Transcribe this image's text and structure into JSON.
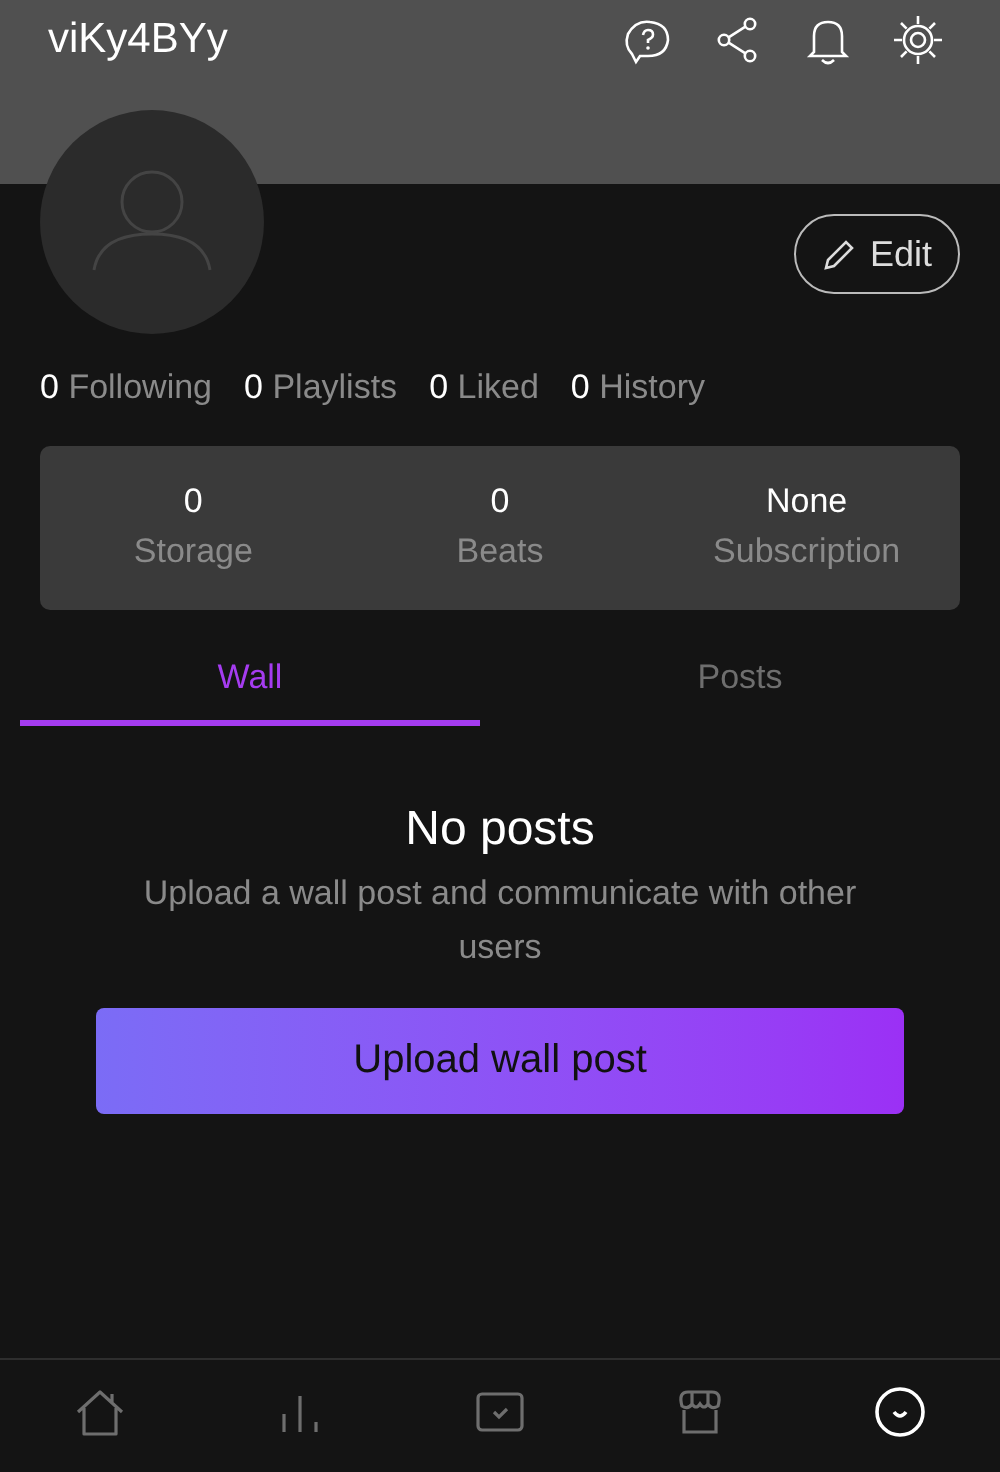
{
  "header": {
    "username": "viKy4BYy"
  },
  "header_actions": [
    {
      "kind": "help"
    },
    {
      "kind": "share"
    },
    {
      "kind": "bell"
    },
    {
      "kind": "settings"
    }
  ],
  "edit_button": {
    "label": "Edit"
  },
  "counts": [
    {
      "text": "0 Following"
    },
    {
      "text": "0 Playlists"
    },
    {
      "text": "0 Liked"
    },
    {
      "text": "0 History"
    }
  ],
  "stats": [
    {
      "value": "0",
      "label": "Storage"
    },
    {
      "value": "0",
      "label": "Beats"
    },
    {
      "value": "None",
      "label": "Subscription"
    }
  ],
  "tabs": [
    {
      "label": "Wall",
      "selected": true
    },
    {
      "label": "Posts",
      "selected": false
    }
  ],
  "empty_state": {
    "title": "No posts",
    "message": "Upload a wall post and communicate with other users",
    "button": "Upload wall post"
  },
  "bottom_nav": [
    {
      "kind": "home",
      "selected": false
    },
    {
      "kind": "charts",
      "selected": false
    },
    {
      "kind": "tasks",
      "selected": false
    },
    {
      "kind": "store",
      "selected": false
    },
    {
      "kind": "profile",
      "selected": true
    }
  ]
}
